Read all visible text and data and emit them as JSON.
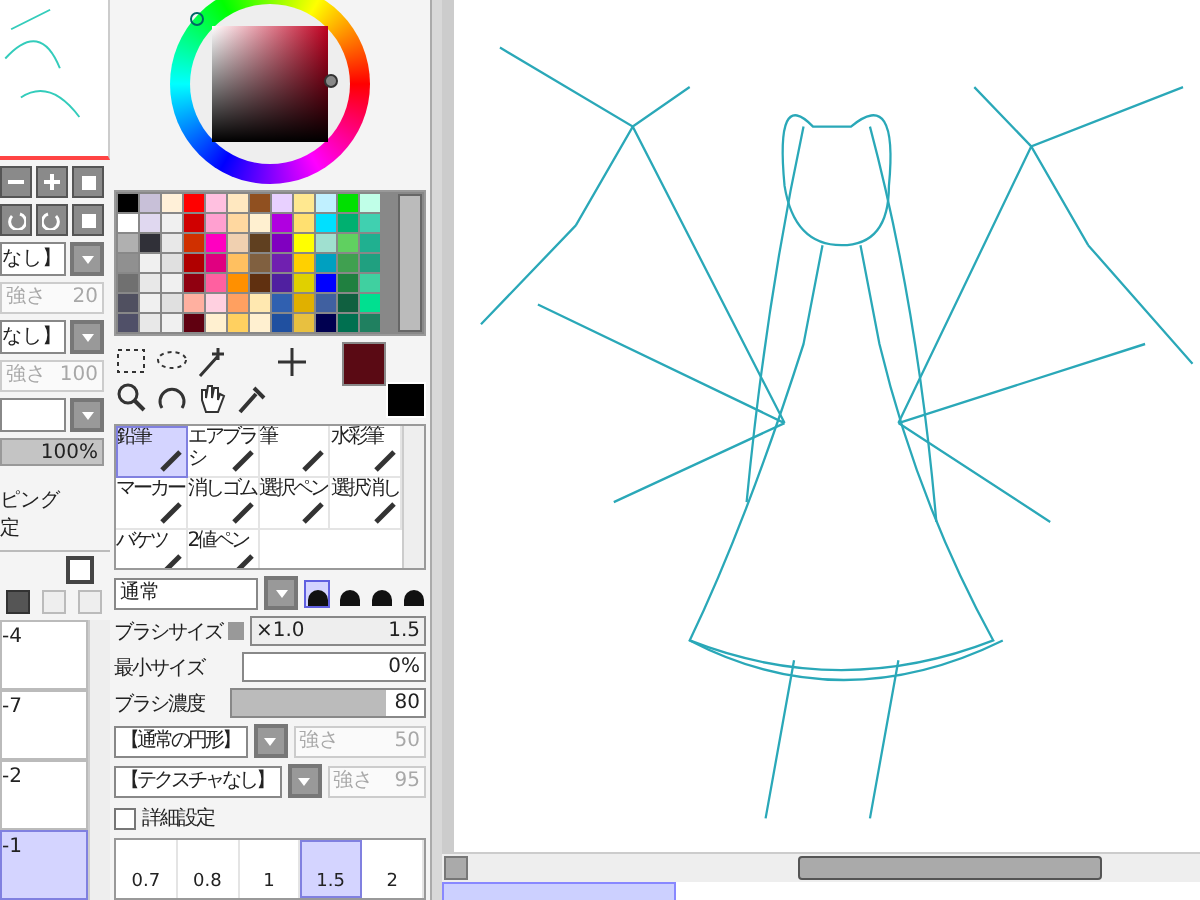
{
  "left_panel": {
    "dropdowns": [
      {
        "label": "なし】"
      },
      {
        "label": "なし】"
      }
    ],
    "strength_fields": [
      {
        "label": "強さ",
        "value": "20",
        "disabled": true
      },
      {
        "label": "強さ",
        "value": "100",
        "disabled": true
      }
    ],
    "opacity": {
      "reading": "100%",
      "level": 1
    },
    "options": [
      "ピング",
      "定"
    ],
    "layers": [
      {
        "name": "-4",
        "selected": false
      },
      {
        "name": "-7",
        "selected": false
      },
      {
        "name": "-2",
        "selected": false
      },
      {
        "name": "-1",
        "selected": true
      }
    ]
  },
  "palette": {
    "rows": [
      {
        "swatches": [
          {
            "color": "#000000"
          },
          {
            "color": "#c8c0d8"
          },
          {
            "color": "#fff0d8"
          },
          {
            "color": "#ff0000"
          },
          {
            "color": "#ffc0e0"
          },
          {
            "color": "#ffe8c0"
          },
          {
            "color": "#905020"
          },
          {
            "color": "#e8d0ff"
          },
          {
            "color": "#ffe890"
          },
          {
            "color": "#c0f0ff"
          },
          {
            "color": "#00e000"
          },
          {
            "color": "#c0ffe8"
          }
        ]
      },
      {
        "swatches": [
          {
            "color": "#ffffff"
          },
          {
            "color": "#e0d8f0"
          },
          {
            "color": "#f0f0f0"
          },
          {
            "color": "#d00000"
          },
          {
            "color": "#ffa0d0"
          },
          {
            "color": "#ffd8a0"
          },
          {
            "color": "#fff0d0"
          },
          {
            "color": "#b000e0"
          },
          {
            "color": "#ffe070"
          },
          {
            "color": "#00e0ff"
          },
          {
            "color": "#00b070"
          },
          {
            "color": "#40d0b0"
          }
        ]
      },
      {
        "swatches": [
          {
            "color": "#b0b0b0"
          },
          {
            "color": "#303038"
          },
          {
            "color": "#e8e8e8"
          },
          {
            "color": "#d03000"
          },
          {
            "color": "#ff00c0"
          },
          {
            "color": "#f0d0b0"
          },
          {
            "color": "#604020"
          },
          {
            "color": "#8000c0"
          },
          {
            "color": "#ffff00"
          },
          {
            "color": "#a0e0d0"
          },
          {
            "color": "#60d060"
          },
          {
            "color": "#20b090"
          }
        ]
      },
      {
        "swatches": [
          {
            "color": "#909090"
          },
          {
            "color": "#f0f0f0"
          },
          {
            "color": "#e0e0e0"
          },
          {
            "color": "#b00000"
          },
          {
            "color": "#e00080"
          },
          {
            "color": "#ffc060"
          },
          {
            "color": "#806040"
          },
          {
            "color": "#7020b0"
          },
          {
            "color": "#ffd000"
          },
          {
            "color": "#00a0c0"
          },
          {
            "color": "#40a050"
          },
          {
            "color": "#20a080"
          }
        ]
      },
      {
        "swatches": [
          {
            "color": "#707070"
          },
          {
            "color": "#e8e8e8"
          },
          {
            "color": "#f0f0f0"
          },
          {
            "color": "#900010"
          },
          {
            "color": "#ff60a0"
          },
          {
            "color": "#ff9000"
          },
          {
            "color": "#603010"
          },
          {
            "color": "#5020a0"
          },
          {
            "color": "#e0d000"
          },
          {
            "color": "#0000ff"
          },
          {
            "color": "#208040"
          },
          {
            "color": "#40d0a0"
          }
        ]
      },
      {
        "swatches": [
          {
            "color": "#505060"
          },
          {
            "color": "#f0f0f0"
          },
          {
            "color": "#e0e0e0"
          },
          {
            "color": "#ffb0a0"
          },
          {
            "color": "#ffd0e0"
          },
          {
            "color": "#ffa060"
          },
          {
            "color": "#ffe8b0"
          },
          {
            "color": "#3060b0"
          },
          {
            "color": "#e0b000"
          },
          {
            "color": "#4060a0"
          },
          {
            "color": "#106040"
          },
          {
            "color": "#00e090"
          }
        ]
      },
      {
        "swatches": [
          {
            "color": "#505068"
          },
          {
            "color": "#e8e8e8"
          },
          {
            "color": "#f0f0f0"
          },
          {
            "color": "#600010"
          },
          {
            "color": "#fff0d0"
          },
          {
            "color": "#ffd060"
          },
          {
            "color": "#fff0d0"
          },
          {
            "color": "#2050a0"
          },
          {
            "color": "#e8c040"
          },
          {
            "color": "#000050"
          },
          {
            "color": "#007050"
          },
          {
            "color": "#208060"
          }
        ]
      }
    ]
  },
  "current_colors": {
    "foreground": {
      "color": "#5a0a14"
    },
    "background": {
      "color": "#000000"
    }
  },
  "tools": [
    {
      "label": "鉛筆",
      "selected": true
    },
    {
      "label": "エアブラシ",
      "selected": false
    },
    {
      "label": "筆",
      "selected": false
    },
    {
      "label": "水彩筆",
      "selected": false
    },
    {
      "label": "マーカー",
      "selected": false
    },
    {
      "label": "消しゴム",
      "selected": false
    },
    {
      "label": "選択ペン",
      "selected": false
    },
    {
      "label": "選択消し",
      "selected": false
    },
    {
      "label": "バケツ",
      "selected": false
    },
    {
      "label": "2値ペン",
      "selected": false
    }
  ],
  "brush": {
    "blend_mode": "通常",
    "shapes": [
      {
        "selected": true
      },
      {
        "selected": false
      },
      {
        "selected": false
      },
      {
        "selected": false
      }
    ],
    "size_label": "ブラシサイズ",
    "size_multiplier": "×1.0",
    "size_value": "1.5",
    "min_size": {
      "label": "最小サイズ",
      "value": "0%",
      "level": 0
    },
    "density": {
      "label": "ブラシ濃度",
      "value": "80",
      "level": 0.8
    },
    "shape_dropdown": "【通常の円形】",
    "shape_strength": {
      "label": "強さ",
      "value": "50",
      "disabled": true
    },
    "texture_dropdown": "【テクスチャなし】",
    "texture_strength": {
      "label": "強さ",
      "value": "95",
      "disabled": true
    },
    "detail_settings": {
      "label": "詳細設定",
      "checked": false
    },
    "size_presets": [
      {
        "label": "0.7",
        "selected": false
      },
      {
        "label": "0.8",
        "selected": false
      },
      {
        "label": "1",
        "selected": false
      },
      {
        "label": "1.5",
        "selected": true
      },
      {
        "label": "2",
        "selected": false
      }
    ]
  }
}
